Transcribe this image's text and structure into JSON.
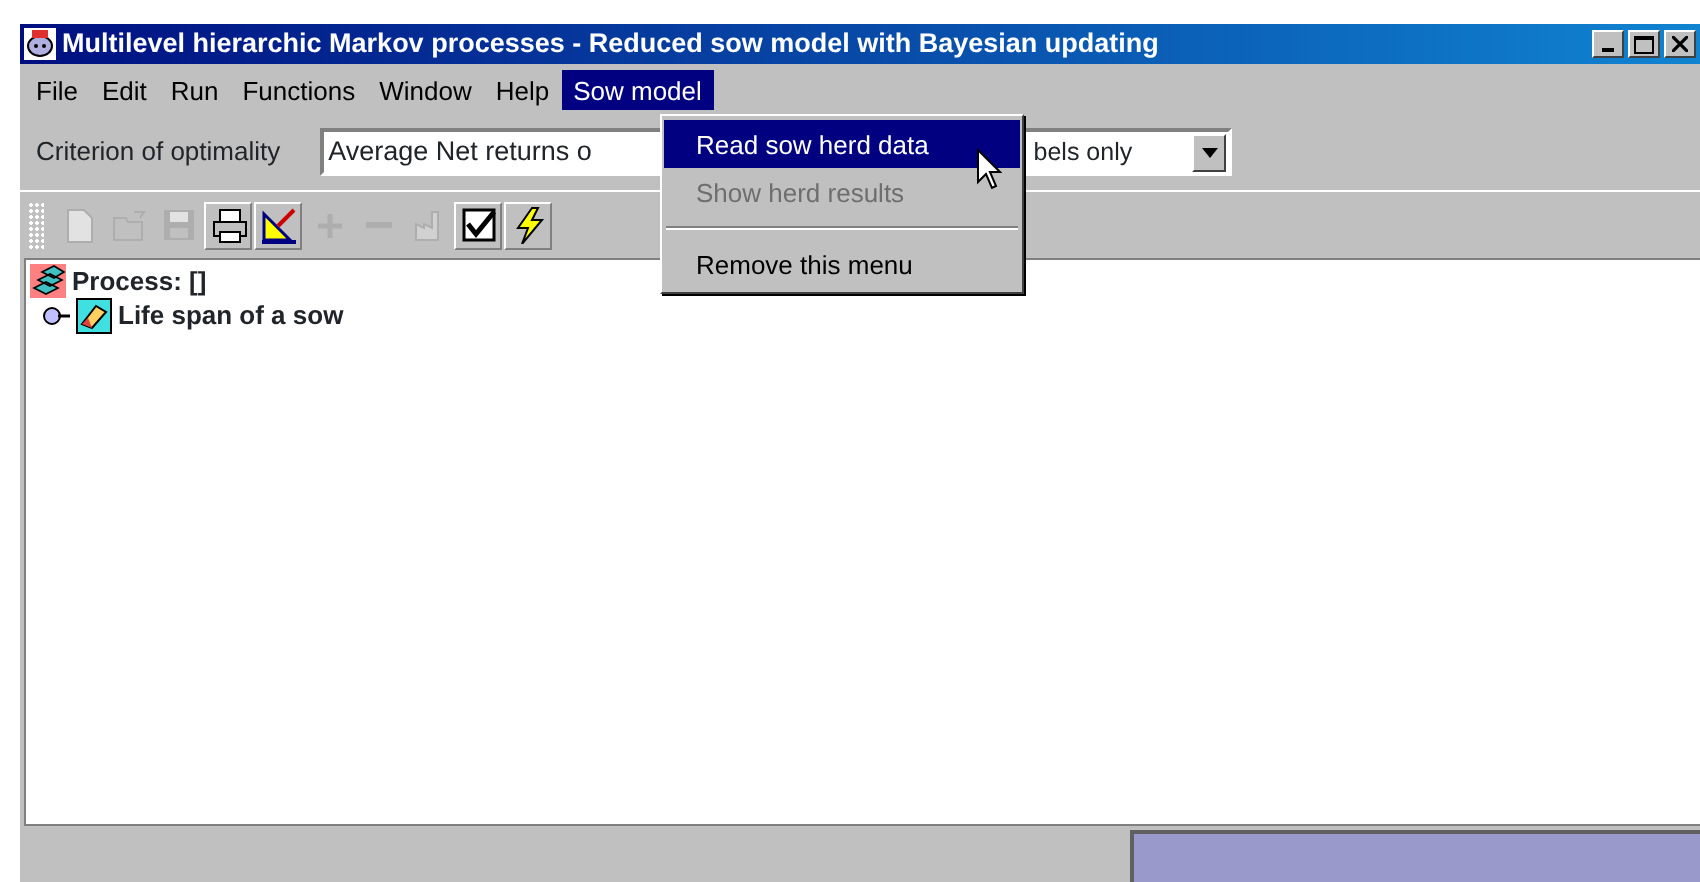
{
  "window": {
    "title": "Multilevel hierarchic Markov processes - Reduced sow model with Bayesian updating"
  },
  "menu_bar": [
    {
      "label": "File",
      "selected": false
    },
    {
      "label": "Edit",
      "selected": false
    },
    {
      "label": "Run",
      "selected": false
    },
    {
      "label": "Functions",
      "selected": false
    },
    {
      "label": "Window",
      "selected": false
    },
    {
      "label": "Help",
      "selected": false
    },
    {
      "label": "Sow model",
      "selected": true
    }
  ],
  "open_menu": {
    "items": [
      {
        "kind": "item",
        "label": "Read sow herd data",
        "selected": true,
        "disabled": false
      },
      {
        "kind": "item",
        "label": "Show herd results",
        "selected": false,
        "disabled": true
      },
      {
        "kind": "separator"
      },
      {
        "kind": "item",
        "label": "Remove this menu",
        "selected": false,
        "disabled": false
      }
    ]
  },
  "criterion": {
    "label": "Criterion of optimality",
    "value_start": "Average Net returns o",
    "value_end": "bels only"
  },
  "toolbar": [
    {
      "kind": "new",
      "disabled": true
    },
    {
      "kind": "open",
      "disabled": true
    },
    {
      "kind": "save",
      "disabled": true
    },
    {
      "kind": "print",
      "disabled": false
    },
    {
      "kind": "setsquare",
      "disabled": false
    },
    {
      "kind": "plus",
      "disabled": true
    },
    {
      "kind": "minus",
      "disabled": true
    },
    {
      "kind": "factory",
      "disabled": true
    },
    {
      "kind": "check",
      "disabled": false
    },
    {
      "kind": "lightning",
      "disabled": false
    }
  ],
  "tree": {
    "label": "Process: []",
    "children": [
      {
        "label": "Life span of a sow",
        "expanded": false
      }
    ]
  }
}
